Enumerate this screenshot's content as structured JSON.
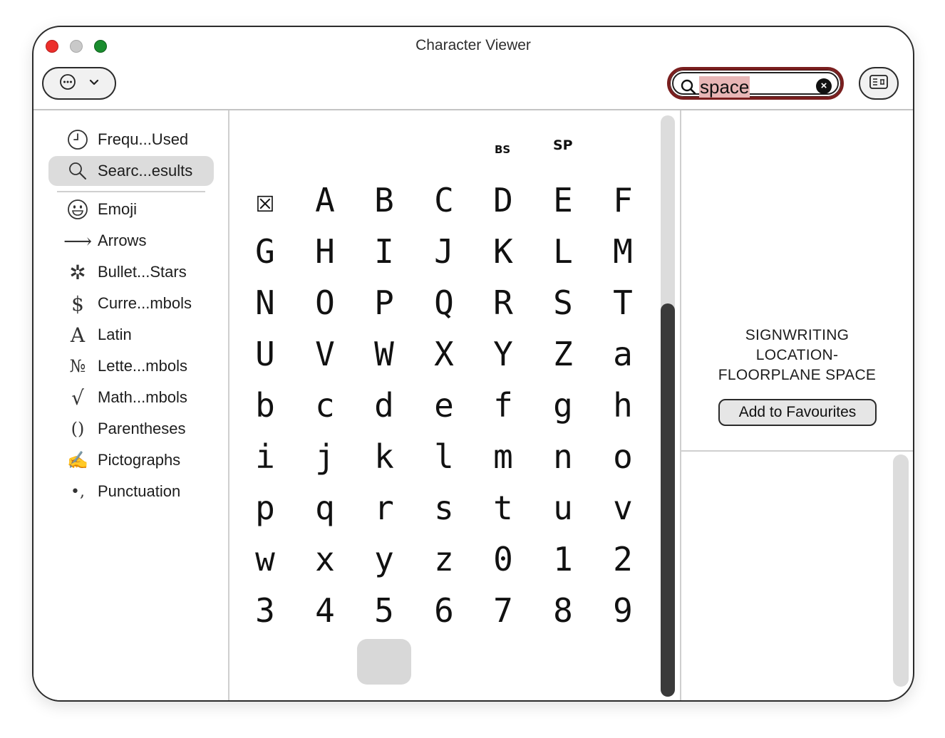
{
  "window": {
    "title": "Character Viewer"
  },
  "toolbar": {
    "view_icon": "more-circle-icon",
    "search": {
      "value": "space",
      "placeholder": ""
    },
    "keyboard_icon": "keyboard-icon"
  },
  "sidebar": {
    "items": [
      {
        "label": "Frequ...Used",
        "icon": "clock-icon",
        "glyph": ""
      },
      {
        "label": "Searc...esults",
        "icon": "magnifier-icon",
        "glyph": "",
        "selected": true
      },
      {
        "label": "Emoji",
        "icon": "smiley-icon",
        "glyph": ""
      },
      {
        "label": "Arrows",
        "icon": "arrow-right-icon",
        "glyph": "⟶"
      },
      {
        "label": "Bullet...Stars",
        "icon": "asterisk-icon",
        "glyph": "✲"
      },
      {
        "label": "Curre...mbols",
        "icon": "dollar-icon",
        "glyph": "$"
      },
      {
        "label": "Latin",
        "icon": "latin-a-icon",
        "glyph": "A"
      },
      {
        "label": "Lette...mbols",
        "icon": "numero-icon",
        "glyph": "№"
      },
      {
        "label": "Math...mbols",
        "icon": "square-root-icon",
        "glyph": "√"
      },
      {
        "label": "Parentheses",
        "icon": "parentheses-icon",
        "glyph": "()"
      },
      {
        "label": "Pictographs",
        "icon": "writing-hand-icon",
        "glyph": "✍"
      },
      {
        "label": "Punctuation",
        "icon": "punctuation-icon",
        "glyph": "•,"
      }
    ]
  },
  "grid": {
    "top_labels": [
      "BS",
      "SP"
    ],
    "rows": [
      [
        "☒",
        "A",
        "B",
        "C",
        "D",
        "E",
        "F"
      ],
      [
        "G",
        "H",
        "I",
        "J",
        "K",
        "L",
        "M"
      ],
      [
        "N",
        "O",
        "P",
        "Q",
        "R",
        "S",
        "T"
      ],
      [
        "U",
        "V",
        "W",
        "X",
        "Y",
        "Z",
        "a"
      ],
      [
        "b",
        "c",
        "d",
        "e",
        "f",
        "g",
        "h"
      ],
      [
        "i",
        "j",
        "k",
        "l",
        "m",
        "n",
        "o"
      ],
      [
        "p",
        "q",
        "r",
        "s",
        "t",
        "u",
        "v"
      ],
      [
        "w",
        "x",
        "y",
        "z",
        "0",
        "1",
        "2"
      ],
      [
        "3",
        "4",
        "5",
        "6",
        "7",
        "8",
        "9"
      ],
      [
        "",
        "",
        " ",
        "",
        "",
        "",
        ""
      ]
    ],
    "selected": {
      "row": 9,
      "col": 2
    }
  },
  "detail": {
    "name_lines": [
      "SIGNWRITING",
      "LOCATION-",
      "FLOORPLANE SPACE"
    ],
    "favourite_button": "Add to Favourites"
  }
}
